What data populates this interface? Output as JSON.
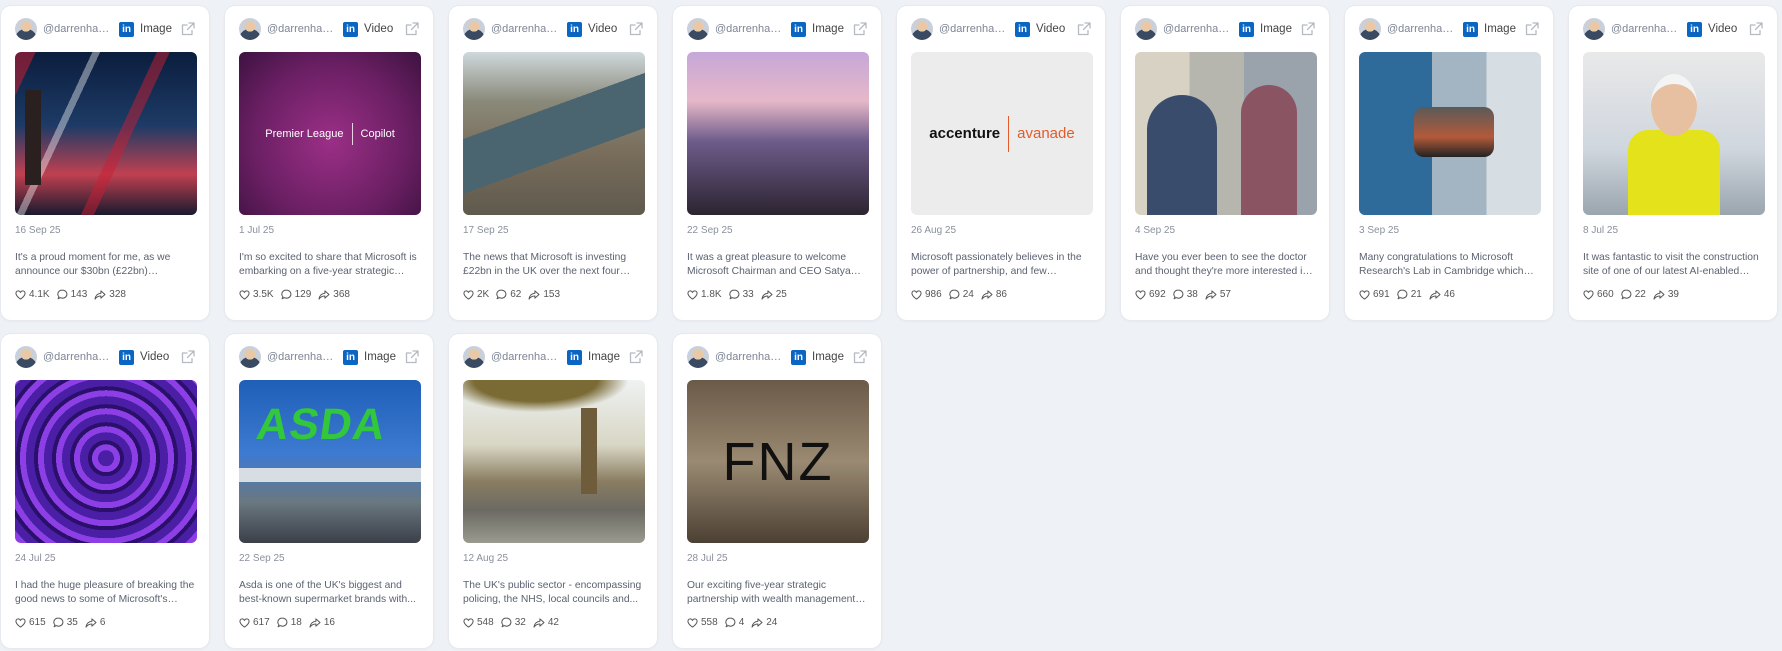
{
  "posts": [
    {
      "handle": "@darrenhardman",
      "platform": "in",
      "type": "Image",
      "thumb": "city",
      "date": "16 Sep 25",
      "text": "It's a proud moment for me, as we announce our $30bn (£22bn) investment in the UK...",
      "likes": "4.1K",
      "comments": "143",
      "shares": "328"
    },
    {
      "handle": "@darrenhardman",
      "platform": "in",
      "type": "Video",
      "thumb": "purple",
      "thumb_text_1": "Premier League",
      "thumb_text_2": "Copilot",
      "date": "1 Jul 25",
      "text": "I'm so excited to share that Microsoft is embarking on a five-year strategic partnership...",
      "likes": "3.5K",
      "comments": "129",
      "shares": "368"
    },
    {
      "handle": "@darrenhardman",
      "platform": "in",
      "type": "Video",
      "thumb": "aerial",
      "date": "17 Sep 25",
      "text": "The news that Microsoft is investing £22bn in the UK over the next four years...",
      "likes": "2K",
      "comments": "62",
      "shares": "153"
    },
    {
      "handle": "@darrenhardman",
      "platform": "in",
      "type": "Image",
      "thumb": "stage",
      "date": "22 Sep 25",
      "text": "It was a great pleasure to welcome Microsoft Chairman and CEO Satya Nadella...",
      "likes": "1.8K",
      "comments": "33",
      "shares": "25"
    },
    {
      "handle": "@darrenhardman",
      "platform": "in",
      "type": "Video",
      "thumb": "accenture",
      "thumb_text_1": "accenture",
      "thumb_text_2": "avanade",
      "date": "26 Aug 25",
      "text": "Microsoft passionately believes in the power of partnership, and few partnerships...",
      "likes": "986",
      "comments": "24",
      "shares": "86"
    },
    {
      "handle": "@darrenhardman",
      "platform": "in",
      "type": "Image",
      "thumb": "office",
      "date": "4 Sep 25",
      "text": "Have you ever been to see the doctor and thought they're more interested in the screen...",
      "likes": "692",
      "comments": "38",
      "shares": "57"
    },
    {
      "handle": "@darrenhardman",
      "platform": "in",
      "type": "Image",
      "thumb": "lab",
      "date": "3 Sep 25",
      "text": "Many congratulations to Microsoft Research's Lab in Cambridge which has...",
      "likes": "691",
      "comments": "21",
      "shares": "46"
    },
    {
      "handle": "@darrenhardman",
      "platform": "in",
      "type": "Video",
      "thumb": "hiviz",
      "date": "8 Jul 25",
      "text": "It was fantastic to visit the construction site of one of our latest AI-enabled datacentres...",
      "likes": "660",
      "comments": "22",
      "shares": "39"
    },
    {
      "handle": "@darrenhardman",
      "platform": "in",
      "type": "Video",
      "thumb": "rings",
      "date": "24 Jul 25",
      "text": "I had the huge pleasure of breaking the good news to some of Microsoft's partners...",
      "likes": "615",
      "comments": "35",
      "shares": "6"
    },
    {
      "handle": "@darrenhardman",
      "platform": "in",
      "type": "Image",
      "thumb": "asda",
      "thumb_text_1": "ASDA",
      "date": "22 Sep 25",
      "text": "Asda is one of the UK's biggest and best-known supermarket brands with...",
      "likes": "617",
      "comments": "18",
      "shares": "16"
    },
    {
      "handle": "@darrenhardman",
      "platform": "in",
      "type": "Image",
      "thumb": "parliament",
      "date": "12 Aug 25",
      "text": "The UK's public sector - encompassing policing, the NHS, local councils and...",
      "likes": "548",
      "comments": "32",
      "shares": "42"
    },
    {
      "handle": "@darrenhardman",
      "platform": "in",
      "type": "Image",
      "thumb": "fnz",
      "thumb_text_1": "FNZ",
      "date": "28 Jul 25",
      "text": "Our exciting five-year strategic partnership with wealth management platform FNZ...",
      "likes": "558",
      "comments": "4",
      "shares": "24"
    }
  ],
  "colors": {
    "linkedin": "#0a66c2",
    "background": "#eef1f6",
    "card": "#ffffff"
  },
  "icons": {
    "platform": "linkedin-icon",
    "external": "external-link-icon",
    "likes": "heart-icon",
    "comments": "comment-icon",
    "shares": "share-icon"
  }
}
